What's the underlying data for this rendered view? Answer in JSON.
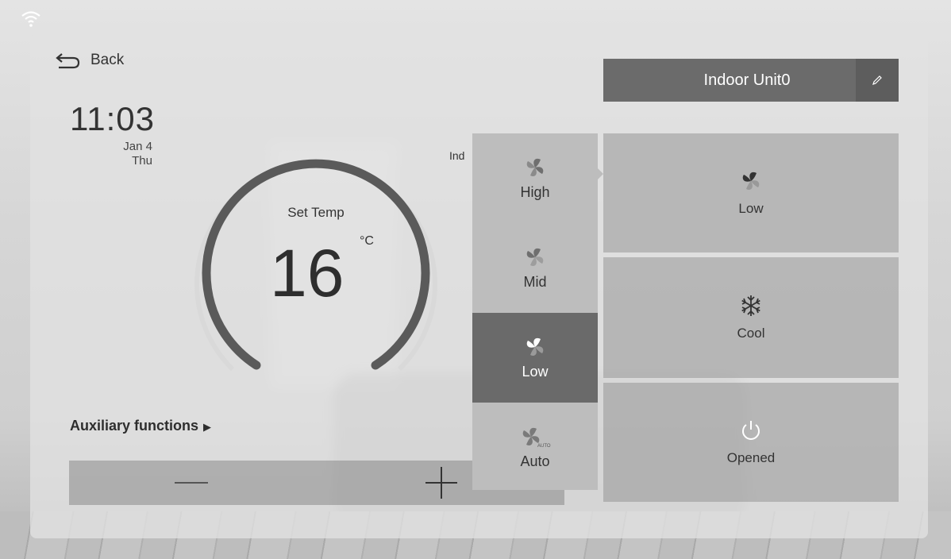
{
  "header": {
    "back_label": "Back",
    "time": "11:03",
    "date": "Jan 4",
    "weekday": "Thu",
    "unit_name": "Indoor Unit0"
  },
  "thermostat": {
    "set_temp_label": "Set Temp",
    "set_temp_value": "16",
    "unit": "°C",
    "indoor_label_partial": "Ind"
  },
  "auxiliary": {
    "label": "Auxiliary functions",
    "arrow": "▶"
  },
  "fan_menu": {
    "options": [
      {
        "label": "High",
        "icon": "fan-icon"
      },
      {
        "label": "Mid",
        "icon": "fan-icon"
      },
      {
        "label": "Low",
        "icon": "fan-icon",
        "selected": true
      },
      {
        "label": "Auto",
        "icon": "fan-auto-icon",
        "badge": "AUTO"
      }
    ]
  },
  "tiles": {
    "fan": {
      "label": "Low",
      "icon": "fan-icon"
    },
    "mode": {
      "label": "Cool",
      "icon": "snowflake-icon"
    },
    "power": {
      "label": "Opened",
      "icon": "power-icon"
    }
  },
  "colors": {
    "selected_bg": "#6a6a6a",
    "arc": "#555555"
  }
}
